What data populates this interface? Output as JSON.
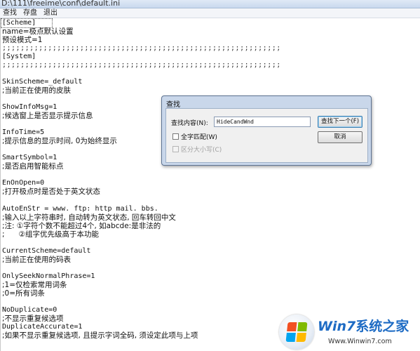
{
  "window": {
    "title": "D:\\111\\freeime\\conf\\default.ini"
  },
  "menu": {
    "items": [
      "查找",
      "存盘",
      "退出"
    ]
  },
  "editor": {
    "lines": [
      "[Scheme]",
      "name=极点默认设置",
      "预设模式=1",
      ";;;;;;;;;;;;;;;;;;;;;;;;;;;;;;;;;;;;;;;;;;;;;;;;;;;;;;;;;;;;;",
      "[System]",
      ";;;;;;;;;;;;;;;;;;;;;;;;;;;;;;;;;;;;;;;;;;;;;;;;;;;;;;;;;;;;;",
      "SkinScheme=_default",
      ";当前正在使用的皮肤",
      "ShowInfoMsg=1",
      ";候选窗上是否显示提示信息",
      "InfoTime=5",
      ";提示信息的显示时间, 0为始终显示",
      "SmartSymbol=1",
      ";是否启用智能标点",
      "EnOnOpen=0",
      ";打开极点时是否处于英文状态",
      "AutoEnStr = www. ftp: http mail. bbs.",
      ";输入以上字符串时, 自动转为英文状态, 回车转回中文",
      ";注: ①字符个数不能超过4个, 如abcde:是非法的",
      ";      ②组字优先级高于本功能",
      "CurrentScheme=default",
      ";当前正在使用的码表",
      "OnlySeekNormalPhrase=1",
      ";1=仅检索常用词条",
      ";0=所有词条",
      "NoDuplicate=0",
      ";不显示重复候选项",
      "DuplicateAccurate=1",
      ";如果不显示重复候选项, 且提示字词全码, 须设定此项与上项"
    ]
  },
  "find_dialog": {
    "title": "查找",
    "find_label": "查找内容(N):",
    "find_value": "HideCandWnd",
    "find_next_button": "查找下一个(F)",
    "cancel_button": "取消",
    "whole_word_label": "全字匹配(W)",
    "match_case_label": "区分大小写(C)"
  },
  "watermark": {
    "brand_prefix": "Win7",
    "brand_suffix": "系统之家",
    "url": "Www.Winwin7.com"
  },
  "colors": {
    "dialog_frame": "#c9d7ea",
    "brand": "#1d6bc4"
  }
}
